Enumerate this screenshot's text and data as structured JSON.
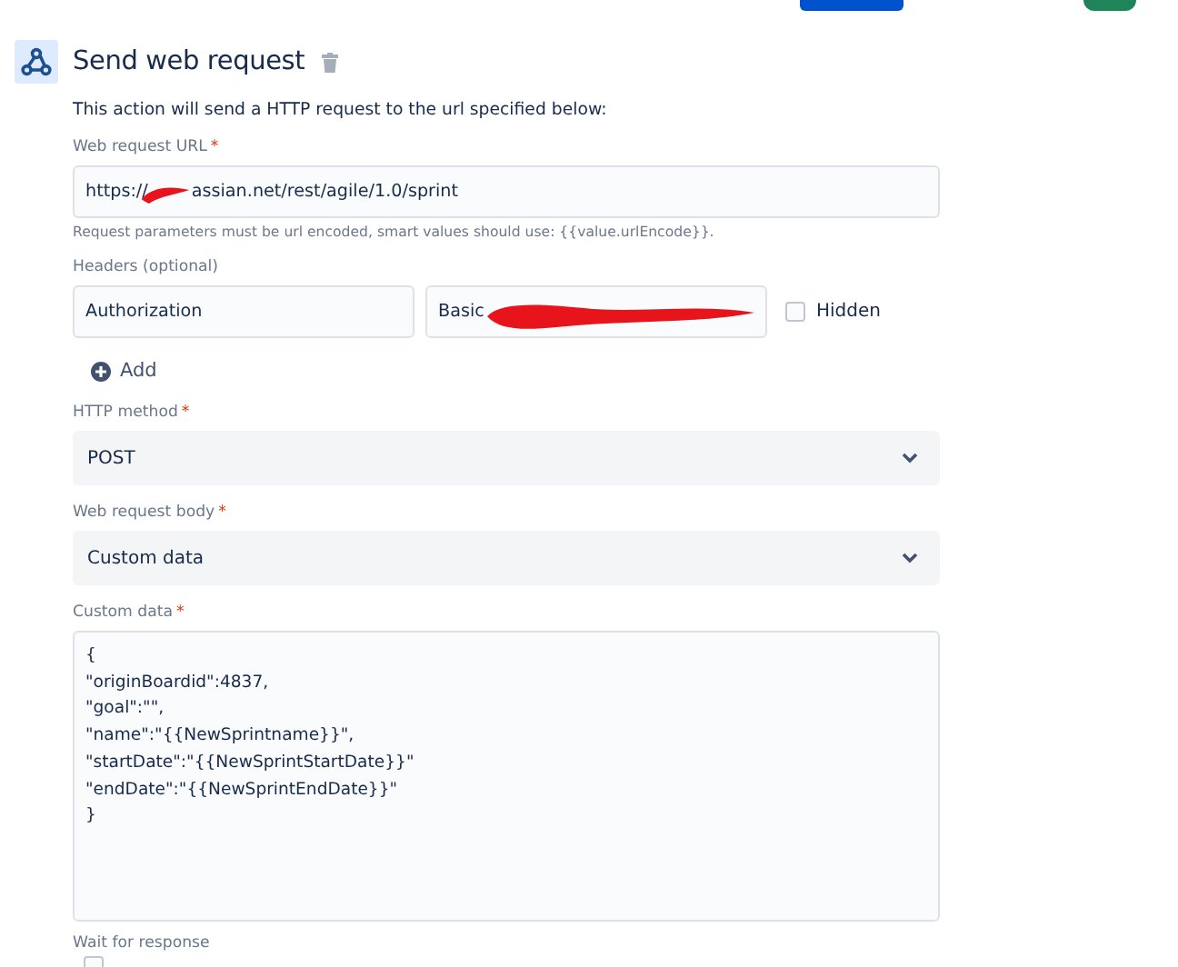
{
  "action": {
    "title": "Send web request",
    "description": "This action will send a HTTP request to the url specified below:"
  },
  "url_field": {
    "label": "Web request URL",
    "required_mark": "*",
    "value_prefix": "https://",
    "value_suffix": "assian.net/rest/agile/1.0/sprint",
    "redacted": true,
    "help": "Request parameters must be url encoded, smart values should use: {{value.urlEncode}}."
  },
  "headers": {
    "label": "Headers (optional)",
    "rows": [
      {
        "key": "Authorization",
        "value": "Basic",
        "redacted": true,
        "hidden_label": "Hidden",
        "hidden": false
      }
    ],
    "add_label": "Add"
  },
  "method_field": {
    "label": "HTTP method",
    "required_mark": "*",
    "value": "POST"
  },
  "body_field": {
    "label": "Web request body",
    "required_mark": "*",
    "value": "Custom data"
  },
  "custom_data": {
    "label": "Custom data",
    "required_mark": "*",
    "lines": [
      "{",
      "\"originBoardid\":4837,",
      "\"goal\":\"\",",
      "\"name\":\"{{NewSprintname}}\",",
      "\"startDate\":\"{{NewSprintStartDate}}\"",
      "\"endDate\":\"{{NewSprintEndDate}}\"",
      "}"
    ]
  },
  "wait_field": {
    "label": "Wait for response",
    "checked": false
  }
}
